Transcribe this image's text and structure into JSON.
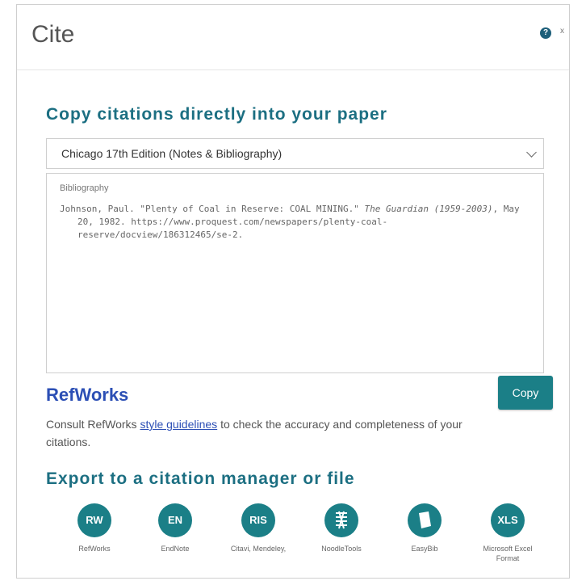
{
  "dialog": {
    "title": "Cite",
    "help_icon": "?",
    "close_icon": "x"
  },
  "copy_section": {
    "heading": "Copy citations directly into your paper",
    "style_select": {
      "value": "Chicago 17th Edition (Notes & Bibliography)"
    },
    "citation": {
      "label": "Bibliography",
      "text_part1": "Johnson, Paul. \"Plenty of Coal in Reserve: COAL MINING.\" ",
      "text_italic": "The Guardian (1959-2003)",
      "text_part2": ", May 20, 1982. https://www.proquest.com/newspapers/plenty-coal-reserve/docview/186312465/se-2."
    }
  },
  "refworks_section": {
    "title": "RefWorks",
    "copy_button": "Copy",
    "consult_prefix": "Consult RefWorks ",
    "consult_link": "style guidelines",
    "consult_suffix": " to check the accuracy and completeness of your citations."
  },
  "export_section": {
    "heading": "Export to a citation manager or file",
    "items": [
      {
        "abbr": "RW",
        "label": "RefWorks"
      },
      {
        "abbr": "EN",
        "label": "EndNote"
      },
      {
        "abbr": "RIS",
        "label": "Citavi, Mendeley,"
      },
      {
        "abbr": "",
        "icon": "noodletools-icon",
        "label": "NoodleTools"
      },
      {
        "abbr": "",
        "icon": "easybib-icon",
        "label": "EasyBib"
      },
      {
        "abbr": "XLS",
        "label": "Microsoft Excel Format"
      }
    ]
  },
  "colors": {
    "accent": "#1c6f82",
    "button": "#1b7f87",
    "link": "#2c4fb5"
  }
}
